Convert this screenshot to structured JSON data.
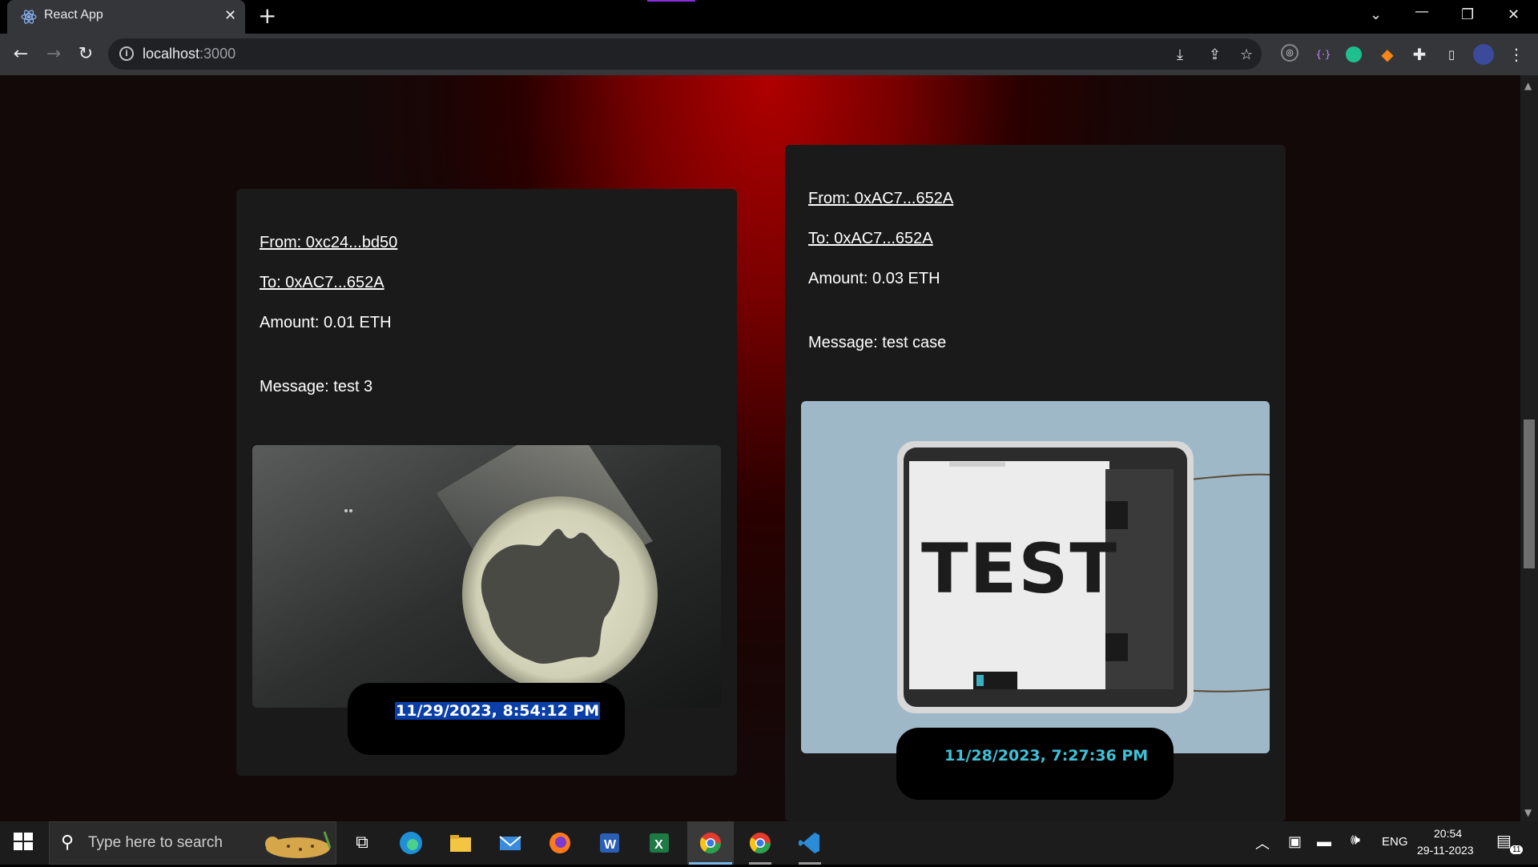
{
  "browser": {
    "tab_title": "React App",
    "url_host": "localhost",
    "url_port": ":3000"
  },
  "cards": [
    {
      "from": "From: 0xc24...bd50",
      "to": "To: 0xAC7...652A",
      "amount": "Amount: 0.01 ETH",
      "message": "Message: test 3",
      "image": "bat-signal-image",
      "timestamp": "11/29/2023, 8:54:12 PM"
    },
    {
      "from": "From: 0xAC7...652A",
      "to": "To: 0xAC7...652A",
      "amount": "Amount: 0.03 ETH",
      "message": "Message: test case",
      "image": "test-printer-image",
      "image_text": "TEST",
      "timestamp": "11/28/2023, 7:27:36 PM"
    }
  ],
  "taskbar": {
    "search_placeholder": "Type here to search",
    "language": "ENG",
    "time": "20:54",
    "date": "29-11-2023",
    "notification_count": "11"
  },
  "colors": {
    "timestamp_selected_bg": "#0a3fa8",
    "timestamp_cyan": "#3fc1d8",
    "page_glow": "#b00000"
  }
}
